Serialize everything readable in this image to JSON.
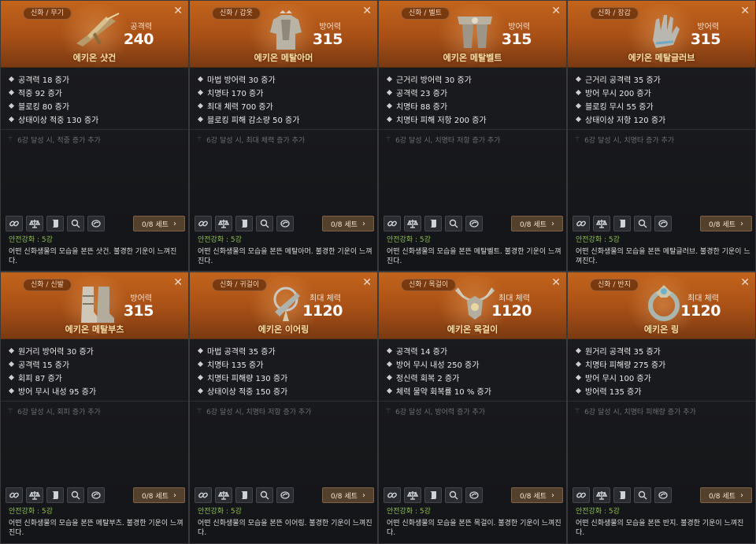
{
  "cards": [
    {
      "category": "신화 / 무기",
      "stat_label": "공격력",
      "stat_value": "240",
      "name": "에키온 샷건",
      "stats": [
        "공격력 18 증가",
        "적중 92 증가",
        "블로킹 80 증가",
        "상태이상 적중 130 증가"
      ],
      "bonus": "6강 달성 시, 적중 증가 추가",
      "set": "0/8 세트",
      "safe": "안전강화 : 5강",
      "desc": "어떤 신화생물의 모습을 본뜬 샷건. 불경한 기운이 느껴진다.",
      "art": "shotgun"
    },
    {
      "category": "신화 / 갑옷",
      "stat_label": "방어력",
      "stat_value": "315",
      "name": "에키온 메탈아머",
      "stats": [
        "마법 방어력 30 증가",
        "치명타 170 증가",
        "최대 체력 700 증가",
        "블로킹 피해 감소량 50 증가"
      ],
      "bonus": "6강 달성 시, 최대 체력 증가 추가",
      "set": "0/8 세트",
      "safe": "안전강화 : 5강",
      "desc": "어떤 신화생물의 모습을 본뜬 메탈아머. 불경한 기운이 느껴진다.",
      "art": "armor"
    },
    {
      "category": "신화 / 벨트",
      "stat_label": "방어력",
      "stat_value": "315",
      "name": "에키온 메탈벨트",
      "stats": [
        "근거리 방어력 30 증가",
        "공격력 23 증가",
        "치명타 88 증가",
        "치명타 피해 저항 200 증가"
      ],
      "bonus": "6강 달성 시, 치명타 저항 증가 추가",
      "set": "0/8 세트",
      "safe": "안전강화 : 5강",
      "desc": "어떤 신화생물의 모습을 본뜬 메탈벨트. 불경한 기운이 느껴진다.",
      "art": "belt"
    },
    {
      "category": "신화 / 장갑",
      "stat_label": "방어력",
      "stat_value": "315",
      "name": "에키온 메탈글러브",
      "stats": [
        "근거리 공격력 35 증가",
        "방어 무시 200 증가",
        "블로킹 무시 55 증가",
        "상태이상 저항 120 증가"
      ],
      "bonus": "6강 달성 시, 치명타 증가 추가",
      "set": "0/8 세트",
      "safe": "안전강화 : 5강",
      "desc": "어떤 신화생물의 모습을 본뜬 메탈글러브. 불경한 기운이 느껴진다.",
      "art": "glove"
    },
    {
      "category": "신화 / 신발",
      "stat_label": "방어력",
      "stat_value": "315",
      "name": "에키온 메탈부츠",
      "stats": [
        "원거리 방어력 30 증가",
        "공격력 15 증가",
        "회피 87 증가",
        "방어 무시 내성 95 증가"
      ],
      "bonus": "6강 달성 시, 회피 증가 추가",
      "set": "0/8 세트",
      "safe": "안전강화 : 5강",
      "desc": "어떤 신화생물의 모습을 본뜬 메탈부츠. 불경한 기운이 느껴진다.",
      "art": "boots"
    },
    {
      "category": "신화 / 귀걸이",
      "stat_label": "최대 체력",
      "stat_value": "1120",
      "name": "에키온 이어링",
      "stats": [
        "마법 공격력 35 증가",
        "치명타 135 증가",
        "치명타 피해량 130 증가",
        "상태이상 적중 150 증가"
      ],
      "bonus": "6강 달성 시, 치명타 저항 증가 추가",
      "set": "0/8 세트",
      "safe": "안전강화 : 5강",
      "desc": "어떤 신화생물의 모습을 본뜬 이어링. 불경한 기운이 느껴진다.",
      "art": "earring"
    },
    {
      "category": "신화 / 목걸이",
      "stat_label": "최대 체력",
      "stat_value": "1120",
      "name": "에키온 목걸이",
      "stats": [
        "공격력 14 증가",
        "방어 무시 내성 250 증가",
        "정신력 회복 2 증가",
        "체력 물약 회복률 10 % 증가"
      ],
      "bonus": "6강 달성 시, 방어력 증가 추가",
      "set": "0/8 세트",
      "safe": "안전강화 : 5강",
      "desc": "어떤 신화생물의 모습을 본뜬 목걸이. 불경한 기운이 느껴진다.",
      "art": "necklace"
    },
    {
      "category": "신화 / 반지",
      "stat_label": "최대 체력",
      "stat_value": "1120",
      "name": "에키온 링",
      "stats": [
        "원거리 공격력 35 증가",
        "치명타 피해량 275 증가",
        "방어 무시 100 증가",
        "방어력 135 증가"
      ],
      "bonus": "6강 달성 시, 치명타 피해량 증가 추가",
      "set": "0/8 세트",
      "safe": "안전강화 : 5강",
      "desc": "어떤 신화생물의 모습을 본뜬 반지. 불경한 기운이 느껴진다.",
      "art": "ring"
    }
  ],
  "close_glyph": "✕",
  "set_chevron": "›",
  "bonus_glyph": "⚚",
  "tool_icons": [
    "link-icon",
    "scale-icon",
    "scroll-icon",
    "magnifier-icon",
    "stone-icon"
  ],
  "colors": {
    "header_orange": "#c2641c",
    "item_name": "#ffe3a8",
    "safe_green": "#8fbf4f",
    "set_button": "#54412d"
  }
}
